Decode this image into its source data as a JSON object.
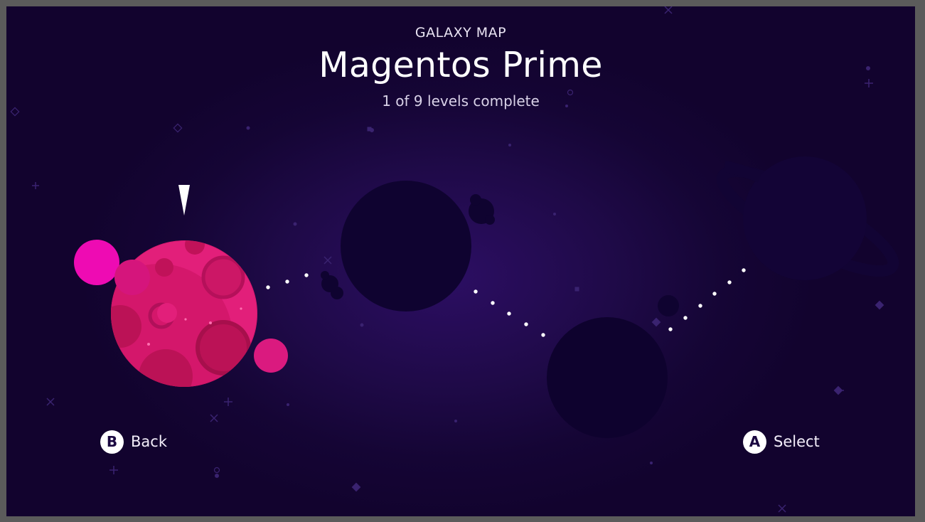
{
  "header": {
    "eyebrow": "GALAXY MAP",
    "title": "Magentos Prime",
    "progress_text": "1 of 9 levels complete"
  },
  "levels": {
    "completed": 1,
    "total": 9,
    "selected_index": 1,
    "planets": [
      {
        "name": "level-1",
        "state": "unlocked"
      },
      {
        "name": "level-2",
        "state": "locked"
      },
      {
        "name": "level-3",
        "state": "locked"
      },
      {
        "name": "level-4",
        "state": "locked"
      }
    ]
  },
  "controls": {
    "back": {
      "key": "B",
      "label": "Back"
    },
    "select": {
      "key": "A",
      "label": "Select"
    }
  },
  "colors": {
    "background": "#150535",
    "planet_unlocked": "#e21f7a",
    "planet_locked": "#0f0330",
    "moon": "#ee0bb3",
    "text": "#ffffff"
  },
  "icons": {
    "cursor": "selection-cursor-icon",
    "path": "dotted-path"
  }
}
